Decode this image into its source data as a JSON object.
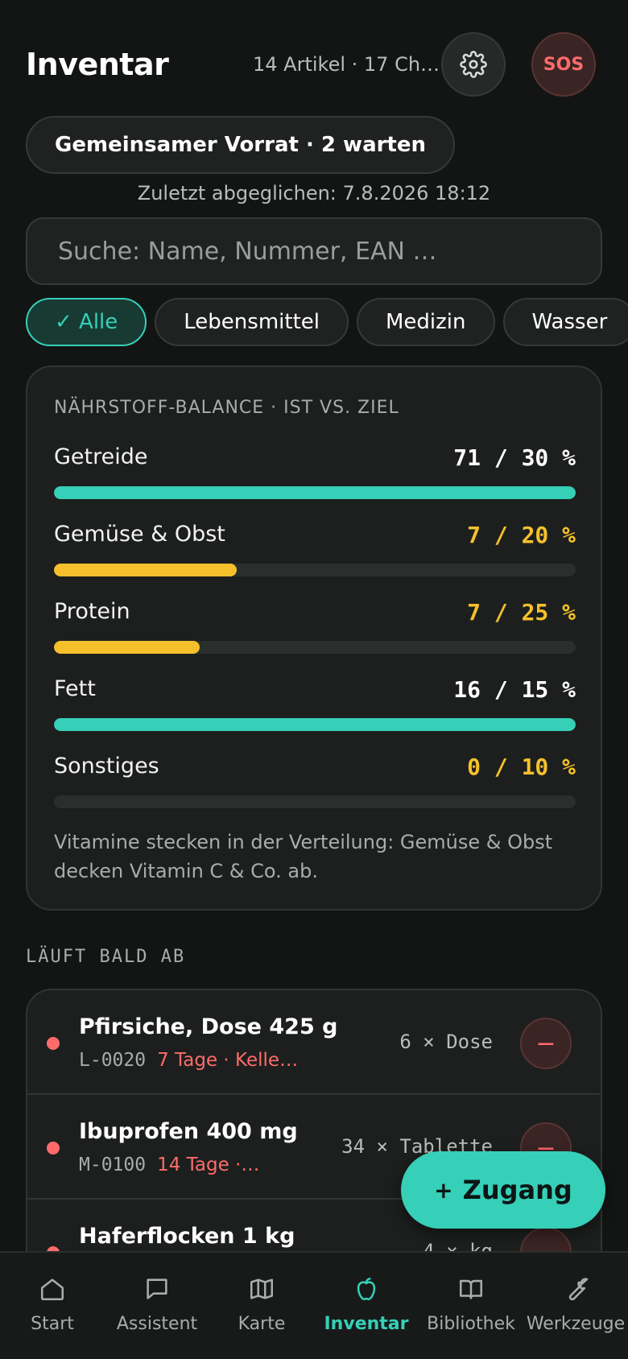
{
  "header": {
    "title": "Inventar",
    "meta": "14 Artikel · 17 Ch…",
    "settings_icon": "gear-icon",
    "sos_label": "SOS"
  },
  "pool_chip": "Gemeinsamer Vorrat · 2 warten",
  "sync_text": "Zuletzt abgeglichen: 7.8.2026 18:12",
  "search": {
    "placeholder": "Suche: Name, Nummer, EAN …",
    "value": ""
  },
  "filters": [
    {
      "label": "✓ Alle",
      "active": true
    },
    {
      "label": "Lebensmittel",
      "active": false
    },
    {
      "label": "Medizin",
      "active": false
    },
    {
      "label": "Wasser",
      "active": false
    }
  ],
  "nutrients": {
    "title": "NÄHRSTOFF-BALANCE · IST VS. ZIEL",
    "rows": [
      {
        "label": "Getreide",
        "value": "71 / 30 %",
        "actual": 71,
        "target": 30,
        "fill_fraction": 1.0,
        "status": "ok"
      },
      {
        "label": "Gemüse & Obst",
        "value": "7 / 20 %",
        "actual": 7,
        "target": 20,
        "fill_fraction": 0.35,
        "status": "warn"
      },
      {
        "label": "Protein",
        "value": "7 / 25 %",
        "actual": 7,
        "target": 25,
        "fill_fraction": 0.28,
        "status": "warn"
      },
      {
        "label": "Fett",
        "value": "16 / 15 %",
        "actual": 16,
        "target": 15,
        "fill_fraction": 1.0,
        "status": "ok"
      },
      {
        "label": "Sonstiges",
        "value": "0 / 10 %",
        "actual": 0,
        "target": 10,
        "fill_fraction": 0.0,
        "status": "warn"
      }
    ],
    "note": "Vitamine stecken in der Verteilung: Gemüse & Obst decken Vitamin C & Co. ab."
  },
  "expiring": {
    "title": "LÄUFT BALD AB",
    "items": [
      {
        "name": "Pfirsiche, Dose 425 g",
        "code": "L-0020",
        "warning": "7 Tage · Kelle…",
        "qty": "6 × Dose"
      },
      {
        "name": "Ibuprofen 400 mg",
        "code": "M-0100",
        "warning": "14 Tage · …",
        "qty": "34 × Tablette"
      },
      {
        "name": "Haferflocken 1 kg",
        "code": "",
        "warning": "",
        "qty": "4 × kg"
      }
    ],
    "minus_label": "−"
  },
  "fab": {
    "plus": "+",
    "label": "Zugang"
  },
  "nav": [
    {
      "label": "Start",
      "icon": "home-icon",
      "active": false
    },
    {
      "label": "Assistent",
      "icon": "chat-icon",
      "active": false
    },
    {
      "label": "Karte",
      "icon": "map-icon",
      "active": false
    },
    {
      "label": "Inventar",
      "icon": "apple-icon",
      "active": true
    },
    {
      "label": "Bibliothek",
      "icon": "book-icon",
      "active": false
    },
    {
      "label": "Werkzeuge",
      "icon": "wrench-icon",
      "active": false
    }
  ],
  "colors": {
    "accent": "#36cfb7",
    "warn": "#f5c02c",
    "danger": "#ff6b6b",
    "background": "#131514"
  }
}
